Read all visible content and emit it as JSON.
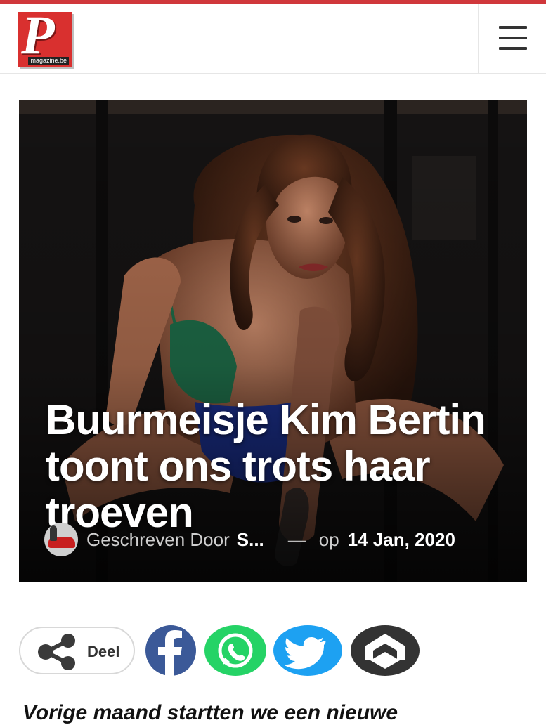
{
  "header": {
    "logo_letter": "P",
    "logo_sub": "magazine.be",
    "menu_icon": "hamburger-menu-icon",
    "accent_color": "#d0373b"
  },
  "article": {
    "title": "Buurmeisje Kim Bertin toont ons trots haar troeven",
    "byline_prefix": "Geschreven Door",
    "author": "S...",
    "separator": "—",
    "date_prefix": "op",
    "date": "14 Jan, 2020"
  },
  "share": {
    "deel_label": "Deel",
    "icons": [
      "share-icon",
      "facebook-icon",
      "whatsapp-icon",
      "twitter-icon",
      "other-share-icon"
    ],
    "colors": {
      "facebook": "#3b5998",
      "whatsapp": "#25d366",
      "twitter": "#1da1f2",
      "other": "#333333"
    }
  },
  "body": {
    "first_line_partial": "Vorige maand startten we een nieuwe"
  }
}
